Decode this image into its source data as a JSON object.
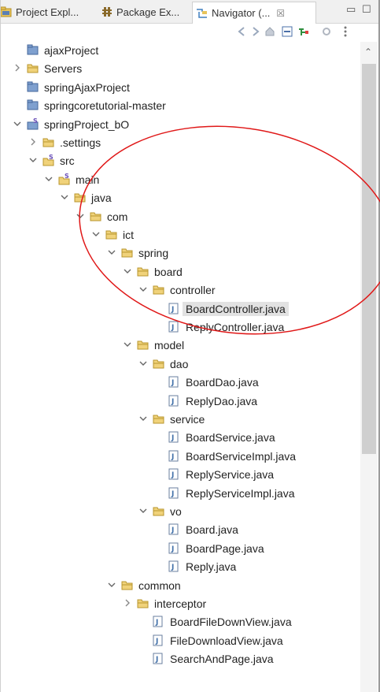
{
  "tabs": [
    {
      "label": "Project Expl...",
      "icon": "project-explorer-icon"
    },
    {
      "label": "Package Ex...",
      "icon": "package-explorer-icon"
    },
    {
      "label": "Navigator (...",
      "icon": "navigator-icon",
      "close": "☒"
    }
  ],
  "window_buttons": {
    "minimize": "▭",
    "maximize": "☐"
  },
  "toolbar": {
    "icons": [
      "back-arrow-icon",
      "forward-arrow-icon",
      "home-icon",
      "collapse-all-icon",
      "link-editor-icon",
      "view-menu-icon"
    ]
  },
  "tree": {
    "items": [
      {
        "label": "ajaxProject",
        "icon": "project",
        "chevron": "none"
      },
      {
        "label": "Servers",
        "icon": "folder",
        "chevron": "collapsed"
      },
      {
        "label": "springAjaxProject",
        "icon": "project",
        "chevron": "none"
      },
      {
        "label": "springcoretutorial-master",
        "icon": "project",
        "chevron": "none"
      },
      {
        "label": "springProject_bO",
        "icon": "spring-project",
        "chevron": "expanded"
      },
      {
        "label": ".settings",
        "icon": "folder",
        "chevron": "collapsed"
      },
      {
        "label": "src",
        "icon": "spring-folder",
        "chevron": "expanded"
      },
      {
        "label": "main",
        "icon": "spring-folder",
        "chevron": "expanded"
      },
      {
        "label": "java",
        "icon": "folder",
        "chevron": "expanded"
      },
      {
        "label": "com",
        "icon": "folder",
        "chevron": "expanded"
      },
      {
        "label": "ict",
        "icon": "folder",
        "chevron": "expanded"
      },
      {
        "label": "spring",
        "icon": "folder",
        "chevron": "expanded"
      },
      {
        "label": "board",
        "icon": "folder",
        "chevron": "expanded"
      },
      {
        "label": "controller",
        "icon": "folder",
        "chevron": "expanded"
      },
      {
        "label": "BoardController.java",
        "icon": "java-file",
        "chevron": "none",
        "selected": true
      },
      {
        "label": "ReplyController.java",
        "icon": "java-file",
        "chevron": "none"
      },
      {
        "label": "model",
        "icon": "folder",
        "chevron": "expanded"
      },
      {
        "label": "dao",
        "icon": "folder",
        "chevron": "expanded"
      },
      {
        "label": "BoardDao.java",
        "icon": "java-file",
        "chevron": "none"
      },
      {
        "label": "ReplyDao.java",
        "icon": "java-file",
        "chevron": "none"
      },
      {
        "label": "service",
        "icon": "folder",
        "chevron": "expanded"
      },
      {
        "label": "BoardService.java",
        "icon": "java-file",
        "chevron": "none"
      },
      {
        "label": "BoardServiceImpl.java",
        "icon": "java-file",
        "chevron": "none"
      },
      {
        "label": "ReplyService.java",
        "icon": "java-file",
        "chevron": "none"
      },
      {
        "label": "ReplyServiceImpl.java",
        "icon": "java-file",
        "chevron": "none"
      },
      {
        "label": "vo",
        "icon": "folder",
        "chevron": "expanded"
      },
      {
        "label": "Board.java",
        "icon": "java-file",
        "chevron": "none"
      },
      {
        "label": "BoardPage.java",
        "icon": "java-file",
        "chevron": "none"
      },
      {
        "label": "Reply.java",
        "icon": "java-file",
        "chevron": "none"
      },
      {
        "label": "common",
        "icon": "folder",
        "chevron": "expanded"
      },
      {
        "label": "interceptor",
        "icon": "folder",
        "chevron": "collapsed"
      },
      {
        "label": "BoardFileDownView.java",
        "icon": "java-file",
        "chevron": "none"
      },
      {
        "label": "FileDownloadView.java",
        "icon": "java-file",
        "chevron": "none"
      },
      {
        "label": "SearchAndPage.java",
        "icon": "java-file",
        "chevron": "none"
      }
    ]
  },
  "annotation": {
    "color": "#e01818"
  },
  "colors": {
    "folder": "#e8c45a",
    "project": "#5b7fb4",
    "java_file": "#3f6fa8",
    "selection": "#e2e2e2"
  }
}
